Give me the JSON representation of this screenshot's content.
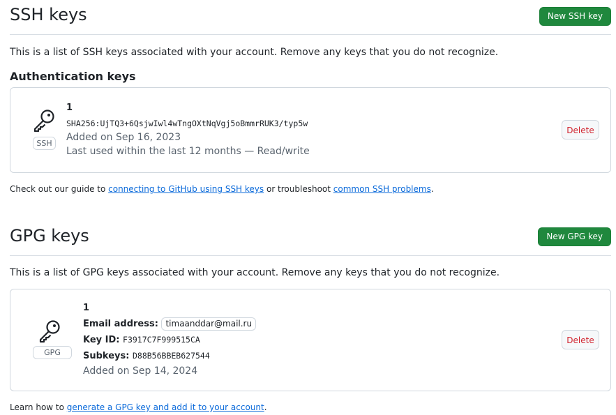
{
  "ssh": {
    "title": "SSH keys",
    "new_button": "New SSH key",
    "description": "This is a list of SSH keys associated with your account. Remove any keys that you do not recognize.",
    "auth_heading": "Authentication keys",
    "key": {
      "title": "1",
      "fingerprint": "SHA256:UjTQ3+6QsjwIwl4wTngOXtNqVgj5oBmmrRUK3/typ5w",
      "added": "Added on Sep 16, 2023",
      "last_used": "Last used within the last 12 months — Read/write",
      "badge": "SSH",
      "icon": "key-icon",
      "delete_label": "Delete"
    },
    "note_prefix": "Check out our guide to ",
    "note_link1": "connecting to GitHub using SSH keys",
    "note_middle": " or troubleshoot ",
    "note_link2": "common SSH problems",
    "note_suffix": "."
  },
  "gpg": {
    "title": "GPG keys",
    "new_button": "New GPG key",
    "description": "This is a list of GPG keys associated with your account. Remove any keys that you do not recognize.",
    "key": {
      "title": "1",
      "email_label": "Email address:",
      "email": "timaanddar@mail.ru",
      "keyid_label": "Key ID:",
      "keyid": "F3917C7F999515CA",
      "subkeys_label": "Subkeys:",
      "subkeys": "D88B56BBEB627544",
      "added": "Added on Sep 14, 2024",
      "badge": "GPG",
      "icon": "key-icon",
      "delete_label": "Delete"
    },
    "note_prefix": "Learn how to ",
    "note_link": "generate a GPG key and add it to your account",
    "note_suffix": "."
  },
  "colors": {
    "primary_button": "#1f883d",
    "danger": "#d1242f",
    "link": "#0969da",
    "muted": "#59636e",
    "border": "#d0d7de"
  }
}
